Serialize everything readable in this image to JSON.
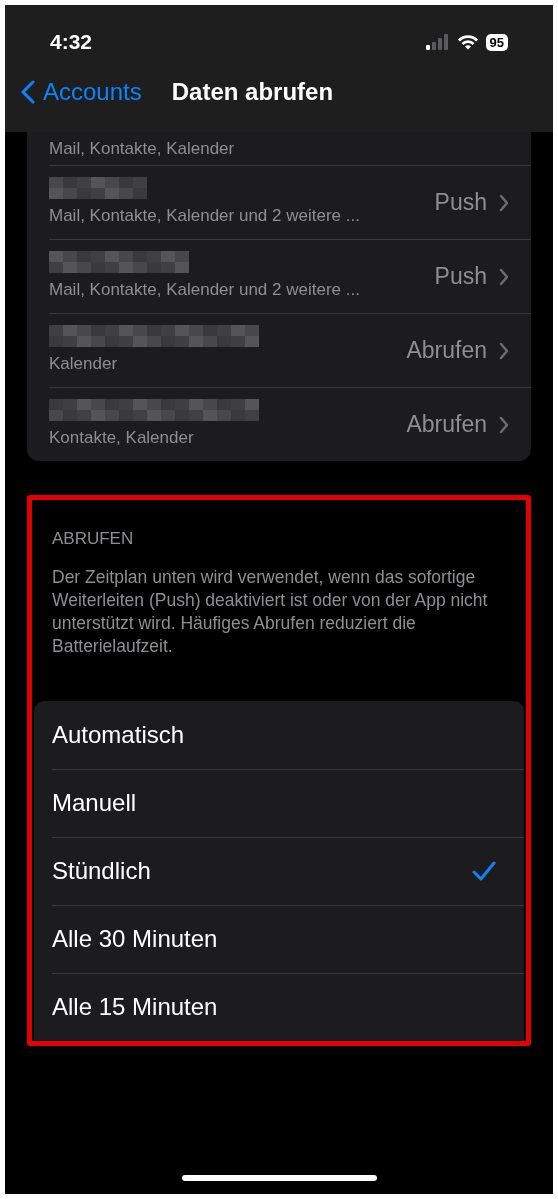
{
  "status_bar": {
    "time": "4:32",
    "battery": "95"
  },
  "nav": {
    "back": "Accounts",
    "title": "Daten abrufen"
  },
  "accounts": [
    {
      "redacted": false,
      "subtitle": "Mail, Kontakte, Kalender"
    },
    {
      "redacted": true,
      "subtitle": "Mail, Kontakte, Kalender und 2 weitere ...",
      "value": "Push"
    },
    {
      "redacted": true,
      "subtitle": "Mail, Kontakte, Kalender und 2 weitere ...",
      "value": "Push"
    },
    {
      "redacted": true,
      "subtitle": "Kalender",
      "value": "Abrufen"
    },
    {
      "redacted": true,
      "subtitle": "Kontakte, Kalender",
      "value": "Abrufen"
    }
  ],
  "fetch_section": {
    "header": "ABRUFEN",
    "footer": "Der Zeitplan unten wird verwendet, wenn das sofortige Weiterleiten (Push) deaktiviert ist oder von der App nicht unterstützt wird. Häufiges Abrufen reduziert die Batterielaufzeit.",
    "options": [
      {
        "label": "Automatisch",
        "selected": false
      },
      {
        "label": "Manuell",
        "selected": false
      },
      {
        "label": "Stündlich",
        "selected": true
      },
      {
        "label": "Alle 30 Minuten",
        "selected": false
      },
      {
        "label": "Alle 15 Minuten",
        "selected": false
      }
    ]
  }
}
